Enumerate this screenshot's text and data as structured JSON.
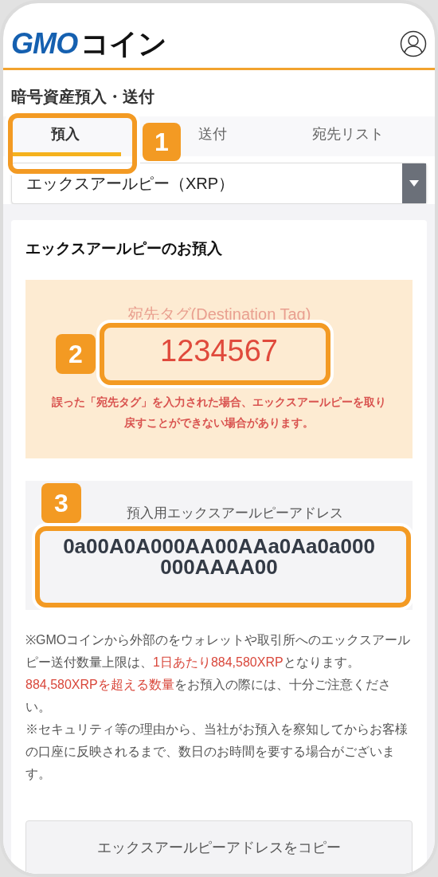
{
  "logo": {
    "latin": "GMO",
    "kana": "コイン"
  },
  "title": "暗号資産預入・送付",
  "tabs": [
    {
      "label": "預入",
      "selected": true
    },
    {
      "label": "送付",
      "selected": false
    },
    {
      "label": "宛先リスト",
      "selected": false
    }
  ],
  "currency_select": {
    "value": "エックスアールピー（XRP）"
  },
  "deposit": {
    "heading": "エックスアールピーのお預入",
    "tag": {
      "label": "宛先タグ(Destination Tag)",
      "value": "1234567",
      "warning": "誤った「宛先タグ」を入力された場合、エックスアールピーを取り戻すことができない場合があります。"
    },
    "address": {
      "label": "預入用エックスアールピーアドレス",
      "value": "0a00A0A000AA00AAa0Aa0a000000AAAA00"
    }
  },
  "notes": [
    [
      {
        "text": "※GMOコインから外部のをウォレットや取引所へのエックスアールピー送付数量上限は、",
        "highlight": false
      },
      {
        "text": "1日あたり884,580XRP",
        "highlight": true
      },
      {
        "text": "となります。",
        "highlight": false
      },
      {
        "text": "884,580XRPを超える数量",
        "highlight": true
      },
      {
        "text": "をお預入の際には、十分ご注意ください。",
        "highlight": false
      }
    ],
    [
      {
        "text": "※セキュリティ等の理由から、当社がお預入を察知してからお客様の口座に反映されるまで、数日のお時間を要する場合がございます。",
        "highlight": false
      }
    ]
  ],
  "copy_button": "エックスアールピーアドレスをコピー",
  "callouts": [
    "1",
    "2",
    "3"
  ]
}
